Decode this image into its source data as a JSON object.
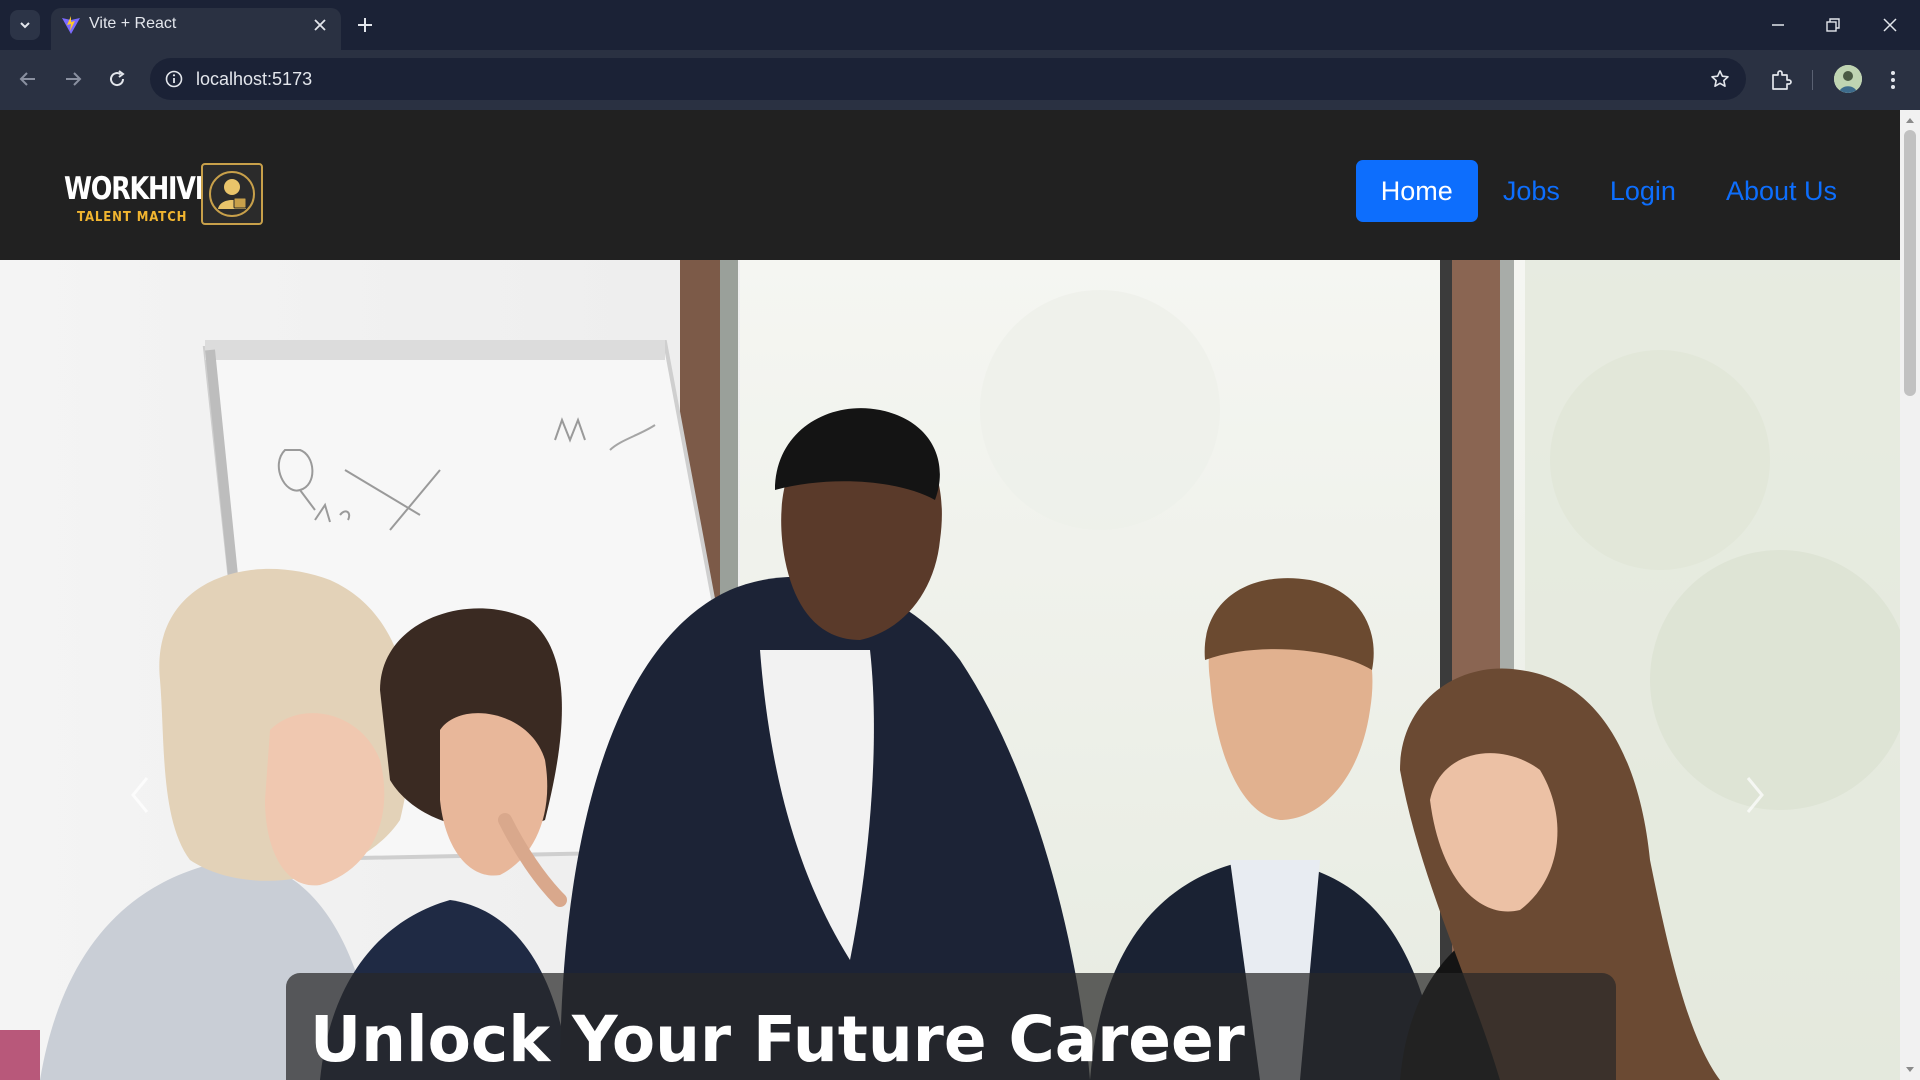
{
  "browser": {
    "tab_title": "Vite + React",
    "url": "localhost:5173"
  },
  "logo": {
    "main": "WORKHIVE",
    "sub": "TALENT MATCH"
  },
  "nav": {
    "items": [
      {
        "label": "Home",
        "active": true
      },
      {
        "label": "Jobs",
        "active": false
      },
      {
        "label": "Login",
        "active": false
      },
      {
        "label": "About Us",
        "active": false
      }
    ]
  },
  "hero": {
    "title": "Unlock Your Future Career",
    "whiteboard_scribble": "Q  M  SOX  No."
  },
  "colors": {
    "accent": "#0d6efd",
    "navbar": "#212121",
    "logo_gold": "#f1b530"
  },
  "icons": {
    "tab_menu": "chevron-down-icon",
    "favicon": "vite-icon",
    "close": "close-icon",
    "new_tab": "plus-icon",
    "back": "arrow-left-icon",
    "forward": "arrow-right-icon",
    "reload": "reload-icon",
    "info": "info-icon",
    "bookmark": "star-icon",
    "extensions": "puzzle-icon",
    "more": "kebab-icon"
  }
}
